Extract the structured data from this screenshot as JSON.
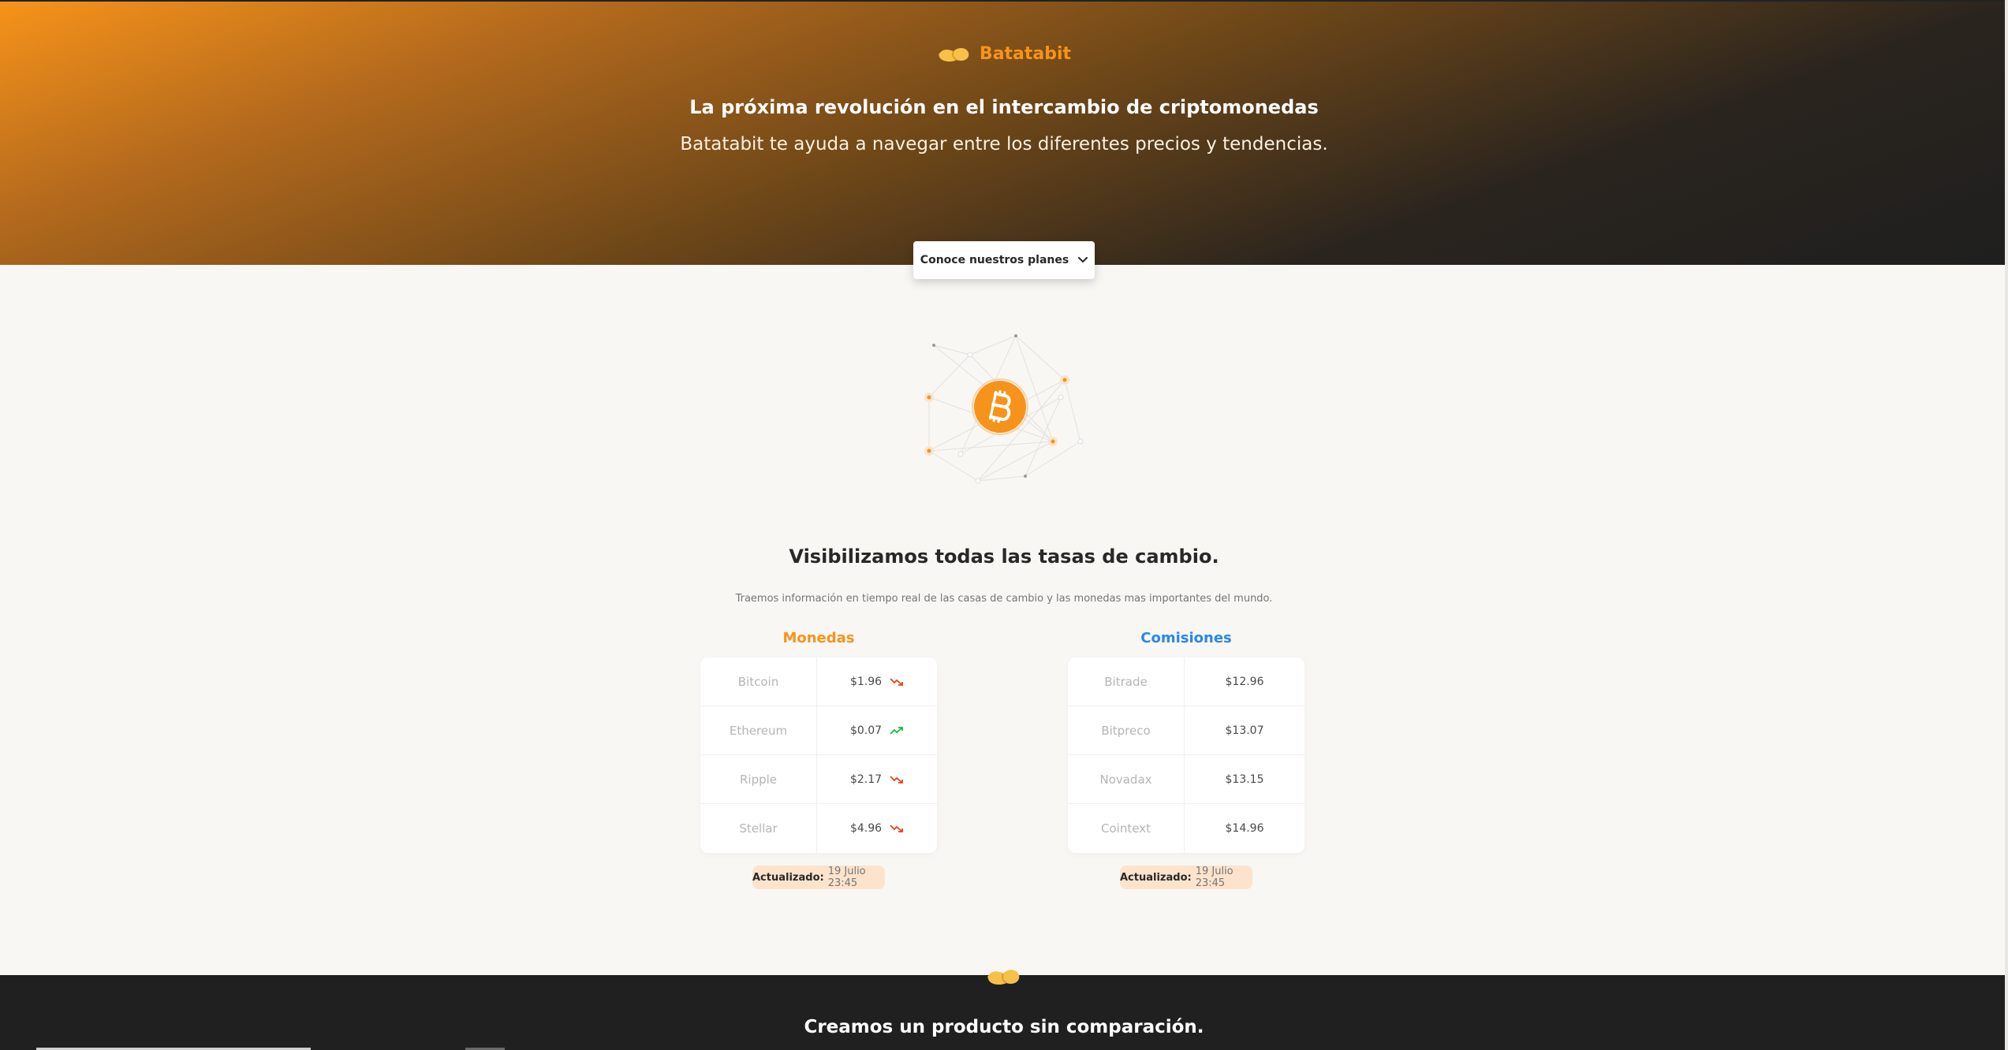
{
  "brand": {
    "name": "Batatabit",
    "logo_icon": "potato-logo-icon",
    "accent": "#f7931a"
  },
  "hero": {
    "title": "La próxima revolución en el intercambio de criptomonedas",
    "subtitle": "Batatabit te ayuda a navegar entre los diferentes precios y tendencias.",
    "plans_button": "Conoce nuestros planes"
  },
  "main": {
    "title": "Visibilizamos todas las tasas de cambio.",
    "description": "Traemos información en tiempo real de las casas de cambio y las monedas mas importantes del mundo."
  },
  "currencies": {
    "title": "Monedas",
    "rows": [
      {
        "name": "Bitcoin",
        "value": "$1.96",
        "trend": "down"
      },
      {
        "name": "Ethereum",
        "value": "$0.07",
        "trend": "up"
      },
      {
        "name": "Ripple",
        "value": "$2.17",
        "trend": "down"
      },
      {
        "name": "Stellar",
        "value": "$4.96",
        "trend": "down"
      }
    ],
    "updated_label": "Actualizado:",
    "updated_date": "19 Julio 23:45"
  },
  "commissions": {
    "title": "Comisiones",
    "rows": [
      {
        "name": "Bitrade",
        "value": "$12.96"
      },
      {
        "name": "Bitpreco",
        "value": "$13.07"
      },
      {
        "name": "Novadax",
        "value": "$13.15"
      },
      {
        "name": "Cointext",
        "value": "$14.96"
      }
    ],
    "updated_label": "Actualizado:",
    "updated_date": "19 Julio 23:45"
  },
  "product": {
    "title": "Creamos un producto sin comparación."
  },
  "colors": {
    "orange": "#f7931a",
    "blue": "#2b87e8",
    "trend_up": "#18b83a",
    "trend_down": "#e8421d"
  }
}
